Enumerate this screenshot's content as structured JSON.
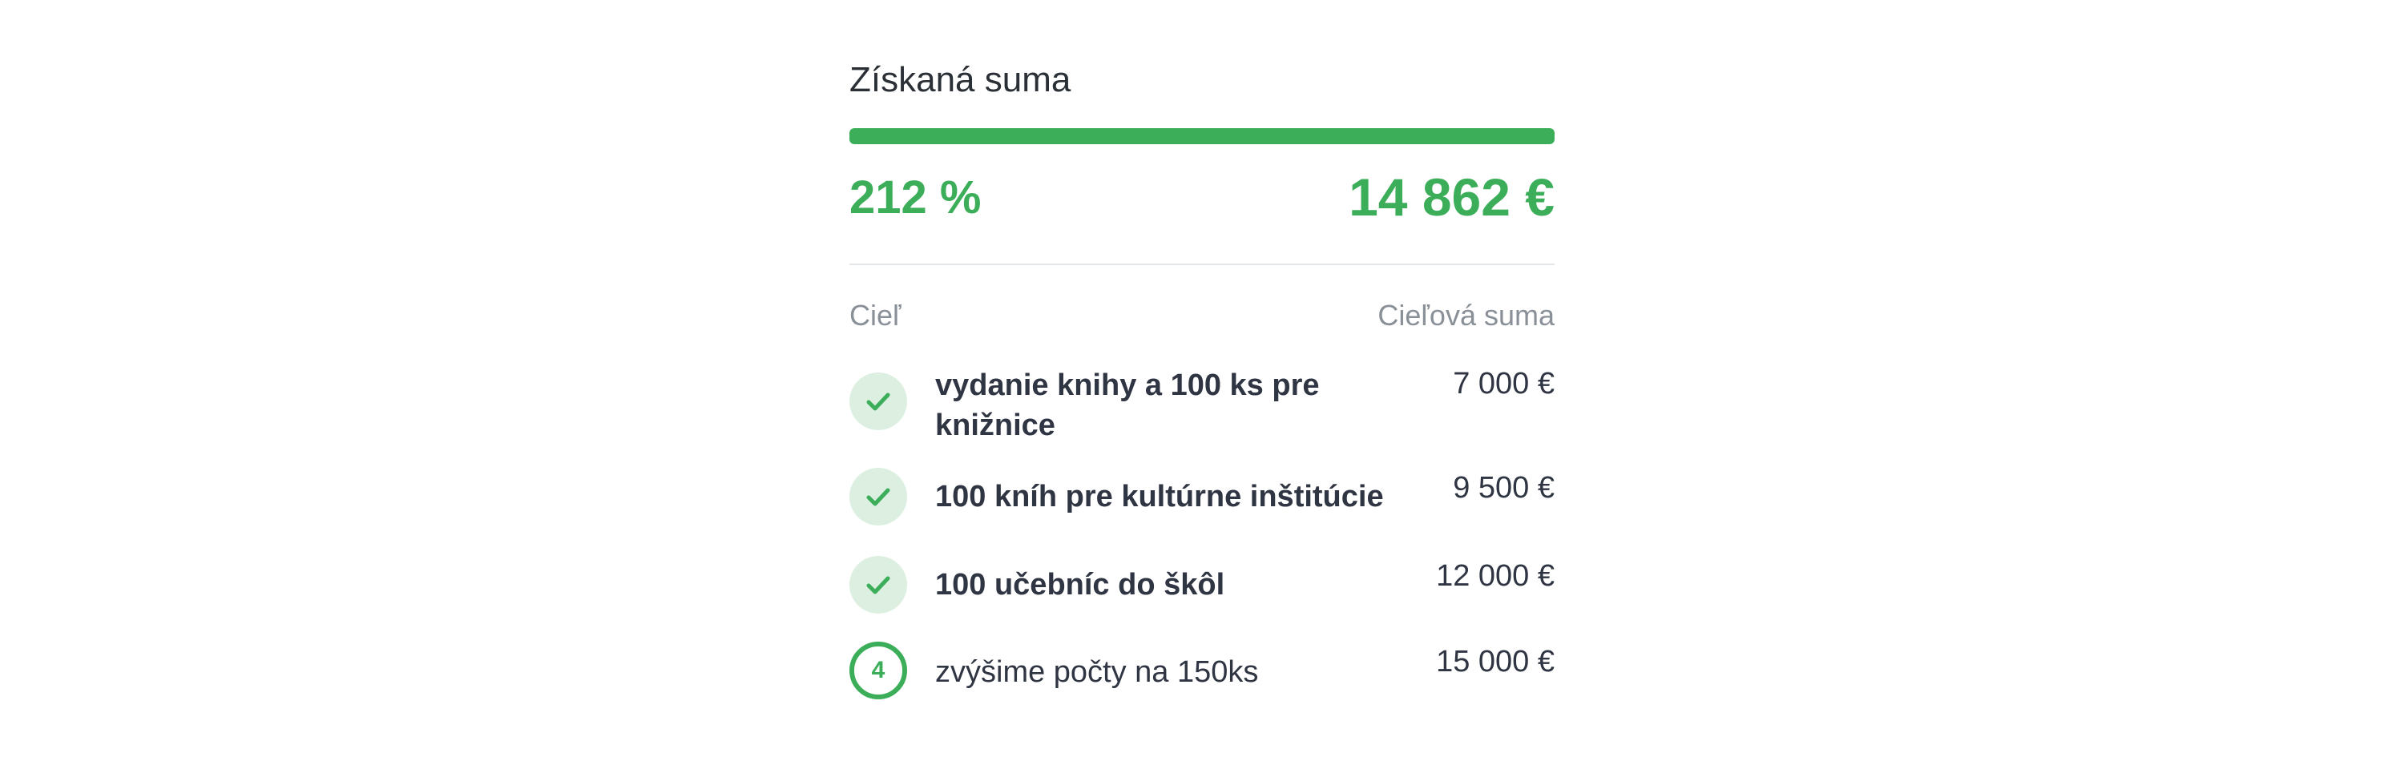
{
  "funding": {
    "title": "Získaná suma",
    "progress_fraction": 1.0,
    "percent_label": "212 %",
    "amount_label": "14 862 €",
    "accent_color": "#3cae5a"
  },
  "goals": {
    "goal_header": "Cieľ",
    "sum_header": "Cieľová suma",
    "items": [
      {
        "text": "vydanie knihy a 100 ks pre knižnice",
        "sum": "7 000 €",
        "status": "done",
        "icon": "check-icon"
      },
      {
        "text": "100 kníh pre kultúrne inštitúcie",
        "sum": "9 500 €",
        "status": "done",
        "icon": "check-icon"
      },
      {
        "text": "100 učebníc do škôl",
        "sum": "12 000 €",
        "status": "done",
        "icon": "check-icon"
      },
      {
        "text": "zvýšime počty na 150ks",
        "sum": "15 000 €",
        "status": "pending",
        "number": "4"
      }
    ]
  }
}
